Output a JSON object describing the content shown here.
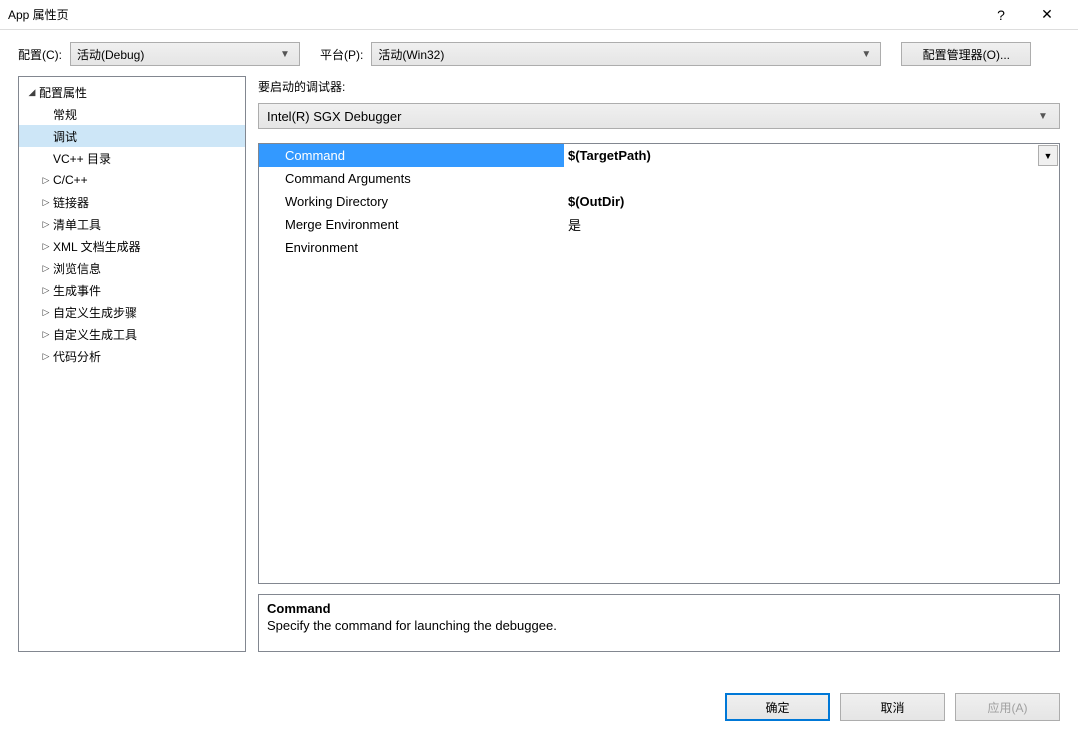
{
  "titlebar": {
    "title": "App 属性页",
    "help": "?",
    "close": "✕"
  },
  "configRow": {
    "configLabel": "配置(C):",
    "configValue": "活动(Debug)",
    "platformLabel": "平台(P):",
    "platformValue": "活动(Win32)",
    "managerBtn": "配置管理器(O)..."
  },
  "tree": {
    "root": "配置属性",
    "items": [
      {
        "label": "常规",
        "expander": false
      },
      {
        "label": "调试",
        "expander": false,
        "selected": true
      },
      {
        "label": "VC++ 目录",
        "expander": false
      },
      {
        "label": "C/C++",
        "expander": true
      },
      {
        "label": "链接器",
        "expander": true
      },
      {
        "label": "清单工具",
        "expander": true
      },
      {
        "label": "XML 文档生成器",
        "expander": true
      },
      {
        "label": "浏览信息",
        "expander": true
      },
      {
        "label": "生成事件",
        "expander": true
      },
      {
        "label": "自定义生成步骤",
        "expander": true
      },
      {
        "label": "自定义生成工具",
        "expander": true
      },
      {
        "label": "代码分析",
        "expander": true
      }
    ]
  },
  "debugger": {
    "label": "要启动的调试器:",
    "value": "Intel(R) SGX Debugger"
  },
  "grid": {
    "rows": [
      {
        "name": "Command",
        "value": "$(TargetPath)",
        "selected": true,
        "bold": true,
        "dropdown": true
      },
      {
        "name": "Command Arguments",
        "value": ""
      },
      {
        "name": "Working Directory",
        "value": "$(OutDir)",
        "bold": true
      },
      {
        "name": "Merge Environment",
        "value": "是"
      },
      {
        "name": "Environment",
        "value": ""
      }
    ]
  },
  "description": {
    "title": "Command",
    "text": "Specify the command for launching the debuggee."
  },
  "dialogButtons": {
    "ok": "确定",
    "cancel": "取消",
    "apply": "应用(A)"
  }
}
